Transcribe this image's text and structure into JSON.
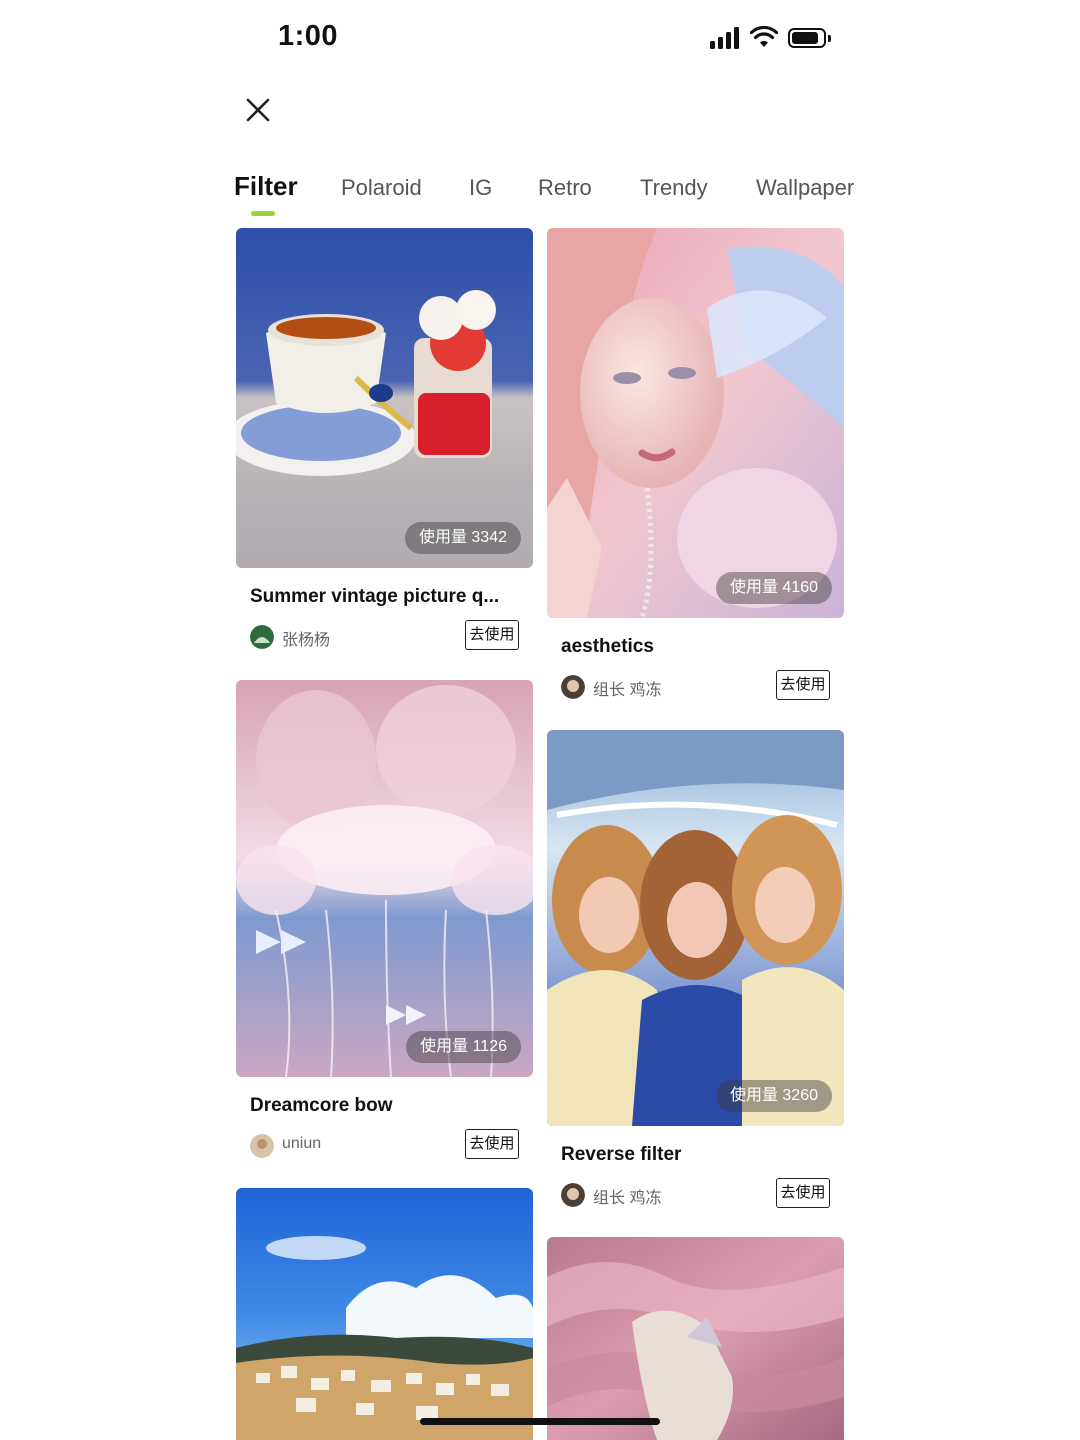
{
  "status_bar": {
    "time": "1:00"
  },
  "tabs": [
    {
      "label": "Filter",
      "active": true
    },
    {
      "label": "Polaroid",
      "active": false
    },
    {
      "label": "IG",
      "active": false
    },
    {
      "label": "Retro",
      "active": false
    },
    {
      "label": "Trendy",
      "active": false
    },
    {
      "label": "Wallpaper",
      "active": false
    }
  ],
  "accent_color": "#9ad633",
  "cards": [
    {
      "title": "Summer vintage picture q...",
      "usage": "使用量 3342",
      "author": "张杨杨",
      "use_label": "去使用",
      "image": "tea-cup-and-strawberry-dessert"
    },
    {
      "title": "aesthetics",
      "usage": "使用量 4160",
      "author": "组长 鸡冻",
      "use_label": "去使用",
      "image": "woman-with-feather-portrait"
    },
    {
      "title": "Dreamcore bow",
      "usage": "使用量 1126",
      "author": "uniun",
      "use_label": "去使用",
      "image": "pink-balloons-with-bows"
    },
    {
      "title": "Reverse filter",
      "usage": "使用量 3260",
      "author": "组长 鸡冻",
      "use_label": "去使用",
      "image": "three-girls-selfie"
    },
    {
      "image": "coastal-town-blue-sky"
    },
    {
      "image": "hand-pink-leaves"
    }
  ]
}
